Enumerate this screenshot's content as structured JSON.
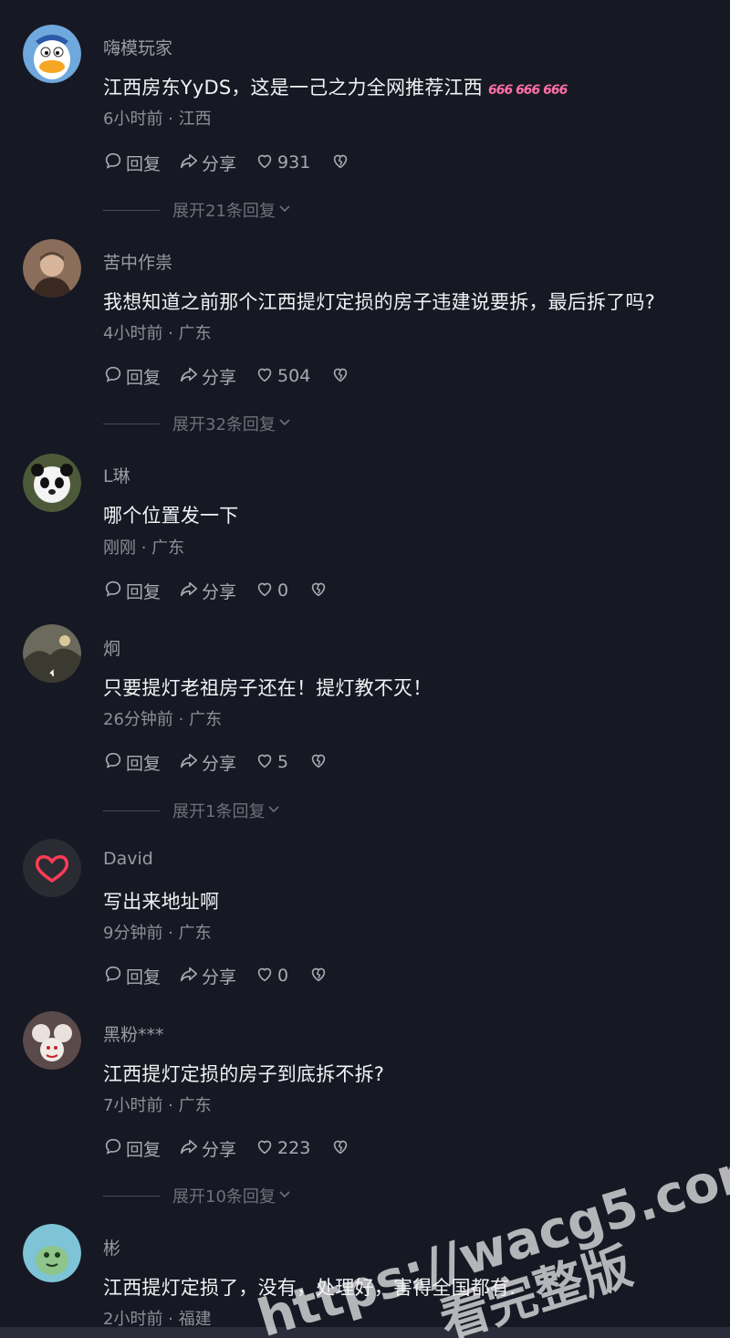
{
  "labels": {
    "reply": "回复",
    "share": "分享"
  },
  "comments": [
    {
      "username": "嗨模玩家",
      "text": "江西房东YyDS，这是一己之力全网推荐江西",
      "emoji": "666 666 666",
      "meta": "6小时前 · 江西",
      "likes": "931",
      "expand": "展开21条回复"
    },
    {
      "username": "苦中作祟",
      "text": "我想知道之前那个江西提灯定损的房子违建说要拆，最后拆了吗?",
      "meta": "4小时前 · 广东",
      "likes": "504",
      "expand": "展开32条回复"
    },
    {
      "username": "L琳",
      "text": "哪个位置发一下",
      "meta": "刚刚 · 广东",
      "likes": "0"
    },
    {
      "username": "炯",
      "text": "只要提灯老祖房子还在！提灯教不灭！",
      "meta": "26分钟前 · 广东",
      "likes": "5",
      "expand": "展开1条回复"
    },
    {
      "username": "David",
      "text": "写出来地址啊",
      "meta": "9分钟前 · 广东",
      "likes": "0"
    },
    {
      "username": "黑粉***",
      "text": "江西提灯定损的房子到底拆不拆?",
      "meta": "7小时前 · 广东",
      "likes": "223",
      "expand": "展开10条回复"
    },
    {
      "username": "彬",
      "text": "江西提灯定损了，没有，处理好，害得全国都有.",
      "meta": "2小时前 · 福建"
    }
  ],
  "watermark": {
    "line1": "https://wacg5.com",
    "line2": "看完整版"
  },
  "colors": {
    "background": "#161823",
    "text": "#f2f2f4",
    "secondary": "#9a9ba3",
    "emoji": "#ff6ea4"
  }
}
